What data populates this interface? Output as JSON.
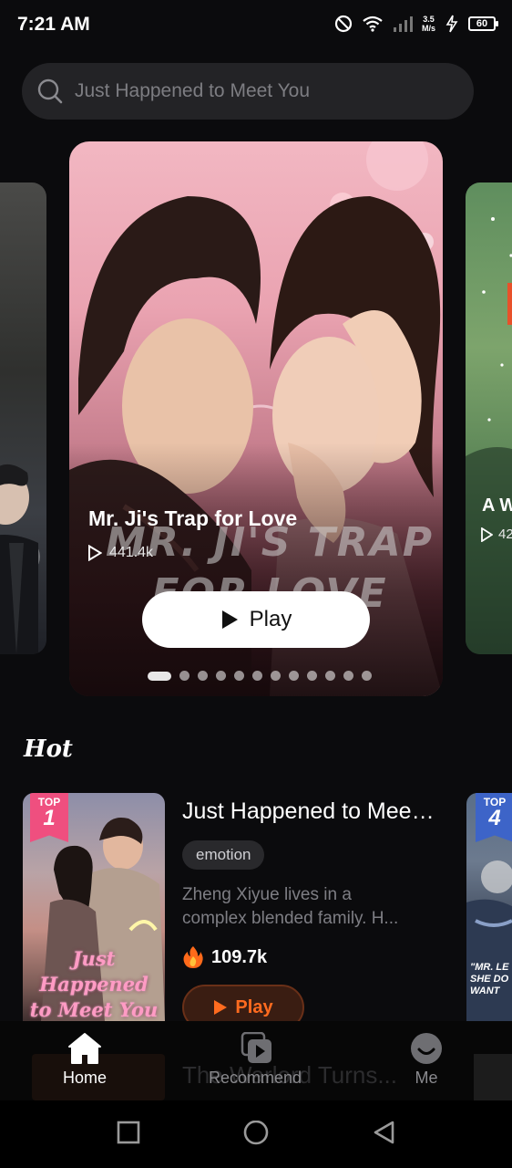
{
  "status_bar": {
    "time": "7:21 AM",
    "net_speed_value": "3.5",
    "net_speed_unit": "M/s",
    "battery": "60",
    "icons": [
      "do-not-disturb-icon",
      "wifi-icon",
      "signal-icon",
      "battery-charging-icon"
    ]
  },
  "search": {
    "placeholder": "Just Happened to Meet You",
    "icon": "search-icon"
  },
  "carousel": {
    "hero": {
      "title": "Mr. Ji's Trap for Love",
      "views": "441.4k",
      "watermark_line1": "MR. JI'S TRAP",
      "watermark_line2": "FOR LOVE",
      "play_label": "Play"
    },
    "next": {
      "title": "A W",
      "views": "42"
    },
    "dots_total": 12,
    "active_index": 0
  },
  "hot": {
    "section_title": "Hot",
    "featured": {
      "rank_label": "TOP",
      "rank": "1",
      "title": "Just Happened to Meet You",
      "tag": "emotion",
      "desc_line1": "Zheng Xiyue lives in a",
      "desc_line2": "complex blended family. H...",
      "heat": "109.7k",
      "play_label": "Play",
      "cover_line1": "Just Happened",
      "cover_line2": "to Meet You"
    },
    "next": {
      "rank_label": "TOP",
      "rank": "4",
      "cover_text": "\"MR. LE\nSHE DO\nWANT"
    }
  },
  "peek_row": {
    "title": "The Warlord Turns..."
  },
  "bottom_nav": {
    "items": [
      {
        "label": "Home",
        "icon": "home-icon",
        "active": true
      },
      {
        "label": "Recommend",
        "icon": "recommend-icon",
        "active": false
      },
      {
        "label": "Me",
        "icon": "smiley-icon",
        "active": false
      }
    ]
  },
  "system_nav": [
    "recents-button",
    "home-button",
    "back-button"
  ],
  "colors": {
    "background": "#0b0b0d",
    "accent_orange": "#ff6b1f",
    "rank_pink": "#ef4f7f",
    "rank_blue": "#3d64c8"
  }
}
